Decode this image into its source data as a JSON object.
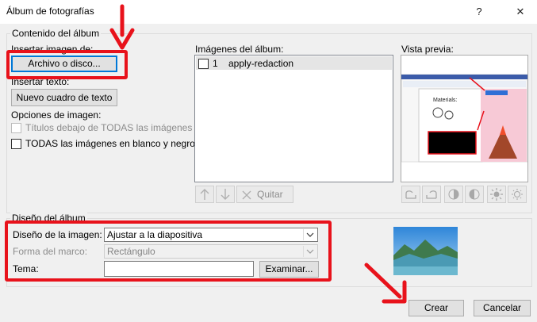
{
  "window": {
    "title": "Álbum de fotografías",
    "help_label": "?",
    "close_label": "✕"
  },
  "content_group": {
    "legend": "Contenido del álbum",
    "insert_image_label": "Insertar imagen de:",
    "file_button": "Archivo o disco...",
    "insert_text_label": "Insertar texto:",
    "new_textbox_button": "Nuevo cuadro de texto",
    "image_options_label": "Opciones de imagen:",
    "captions_option": "Títulos debajo de TODAS las imágenes",
    "bw_option": "TODAS las imágenes en blanco y negro"
  },
  "album_images": {
    "label": "Imágenes del álbum:",
    "items": [
      {
        "index": "1",
        "name": "apply-redaction"
      }
    ],
    "remove_button": "Quitar"
  },
  "preview": {
    "label": "Vista previa:"
  },
  "layout_group": {
    "legend": "Diseño del álbum",
    "picture_layout_label": "Diseño de la imagen:",
    "picture_layout_value": "Ajustar a la diapositiva",
    "frame_shape_label": "Forma del marco:",
    "frame_shape_value": "Rectángulo",
    "theme_label": "Tema:",
    "theme_value": "",
    "browse_button": "Examinar..."
  },
  "footer": {
    "create_button": "Crear",
    "cancel_button": "Cancelar"
  },
  "colors": {
    "annotation_red": "#e8121b",
    "focus_blue": "#0078d7"
  }
}
